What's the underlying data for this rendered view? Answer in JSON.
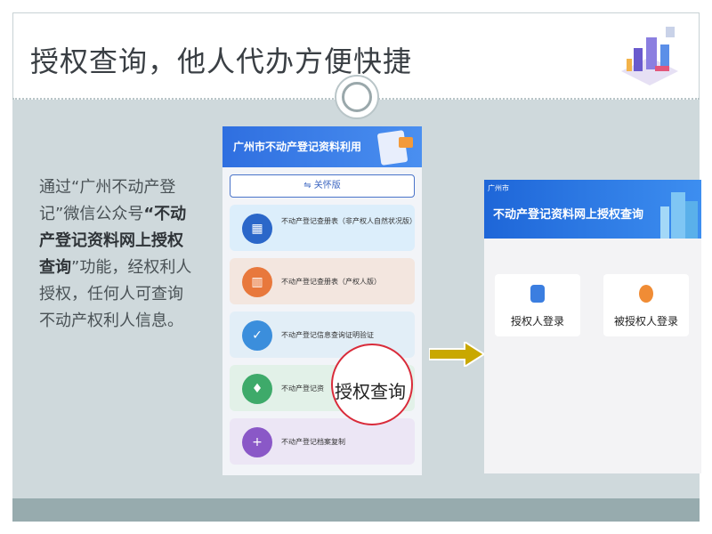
{
  "slide": {
    "title": "授权查询，他人代办方便快捷",
    "description_parts": {
      "p1": "通过“广州不动产登记”微信公众号",
      "p2_bold": "“不动产登记资料网上授权查询",
      "p3": "”功能，经权利人授权，任何人可查询不动产权利人信息。"
    }
  },
  "phone1": {
    "header_title": "广州市不动产登记资料利用",
    "care_button": "⇋ 关怀版",
    "items": [
      {
        "label": "不动产登记查册表（非产权人自然状况版）",
        "icon": "building-doc-icon"
      },
      {
        "label": "不动产登记查册表（产权人版）",
        "icon": "building-icon"
      },
      {
        "label": "不动产登记信息查询证明验证",
        "icon": "shield-check-icon"
      },
      {
        "label": "不动产登记资",
        "icon": "authorize-icon"
      },
      {
        "label": "不动产登记档案复制",
        "icon": "copy-plus-icon"
      }
    ],
    "magnify_text": "授权查询"
  },
  "phone2": {
    "city": "广州市",
    "title": "不动产登记资料网上授权查询",
    "cards": [
      {
        "label": "授权人登录",
        "icon": "authorizer-icon"
      },
      {
        "label": "被授权人登录",
        "icon": "authorized-person-icon"
      }
    ]
  },
  "colors": {
    "accent_blue": "#2f6fe0",
    "arrow": "#c9a800",
    "magnify_ring": "#d92b3a",
    "content_bg": "#cfd9dc",
    "band": "#97abae"
  }
}
